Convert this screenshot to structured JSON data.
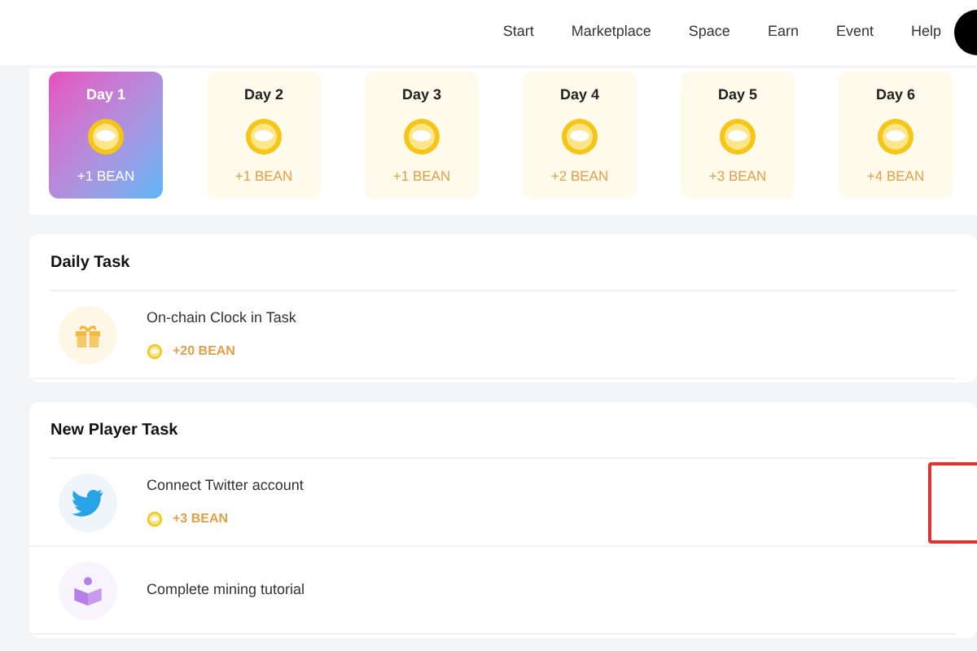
{
  "nav": [
    {
      "label": "Start"
    },
    {
      "label": "Marketplace"
    },
    {
      "label": "Space"
    },
    {
      "label": "Earn"
    },
    {
      "label": "Event"
    },
    {
      "label": "Help"
    }
  ],
  "days": [
    {
      "label": "Day 1",
      "reward": "+1 BEAN",
      "selected": true
    },
    {
      "label": "Day 2",
      "reward": "+1 BEAN",
      "selected": false
    },
    {
      "label": "Day 3",
      "reward": "+1 BEAN",
      "selected": false
    },
    {
      "label": "Day 4",
      "reward": "+2 BEAN",
      "selected": false
    },
    {
      "label": "Day 5",
      "reward": "+3 BEAN",
      "selected": false
    },
    {
      "label": "Day 6",
      "reward": "+4 BEAN",
      "selected": false
    }
  ],
  "sections": [
    {
      "title": "Daily Task",
      "tasks": [
        {
          "kind": "gift",
          "title": "On-chain Clock in Task",
          "reward": "+20 BEAN"
        }
      ]
    },
    {
      "title": "New Player Task",
      "tasks": [
        {
          "kind": "bird",
          "title": "Connect Twitter account",
          "reward": "+3 BEAN",
          "highlighted": true
        },
        {
          "kind": "tutorial",
          "title": "Complete mining tutorial"
        }
      ]
    }
  ]
}
